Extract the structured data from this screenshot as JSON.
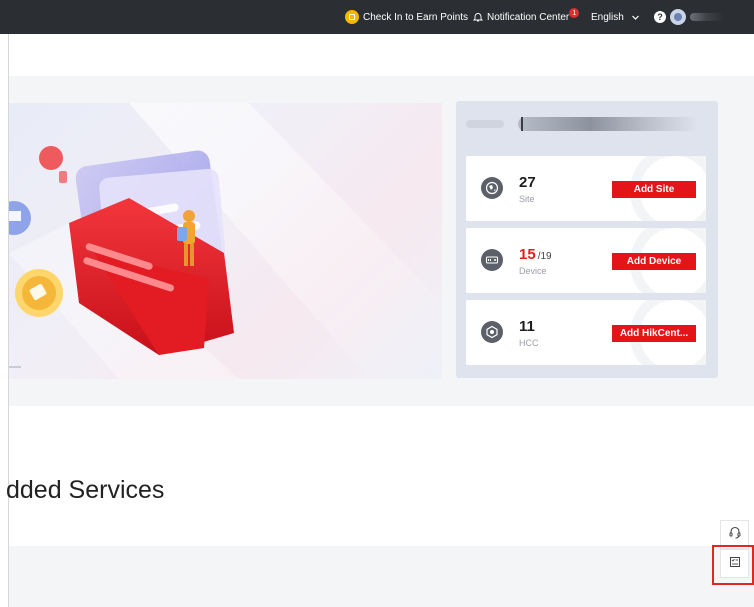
{
  "topbar": {
    "checkin_label": "Check In to Earn Points",
    "notification_label": "Notification Center",
    "notification_count": "1",
    "language": "English",
    "help_symbol": "?",
    "icons": [
      "coin-icon",
      "bell-icon",
      "chevron-down-icon",
      "help-icon",
      "avatar-icon"
    ]
  },
  "stats": [
    {
      "value": "27",
      "total": "",
      "label": "Site",
      "button": "Add Site",
      "icon": "globe-icon",
      "highlight": false
    },
    {
      "value": "15",
      "total": "/19",
      "label": "Device",
      "button": "Add Device",
      "icon": "device-icon",
      "highlight": true
    },
    {
      "value": "11",
      "total": "",
      "label": "HCC",
      "button": "Add HikCent...",
      "icon": "hcc-icon",
      "highlight": false
    }
  ],
  "section": {
    "title": "dded Services"
  },
  "tools": [
    "headset-icon",
    "checklist-icon"
  ],
  "colors": {
    "topbar": "#2b2e33",
    "accent_red": "#e3151b",
    "badge": "#e52b2b",
    "coin": "#f5b700"
  }
}
